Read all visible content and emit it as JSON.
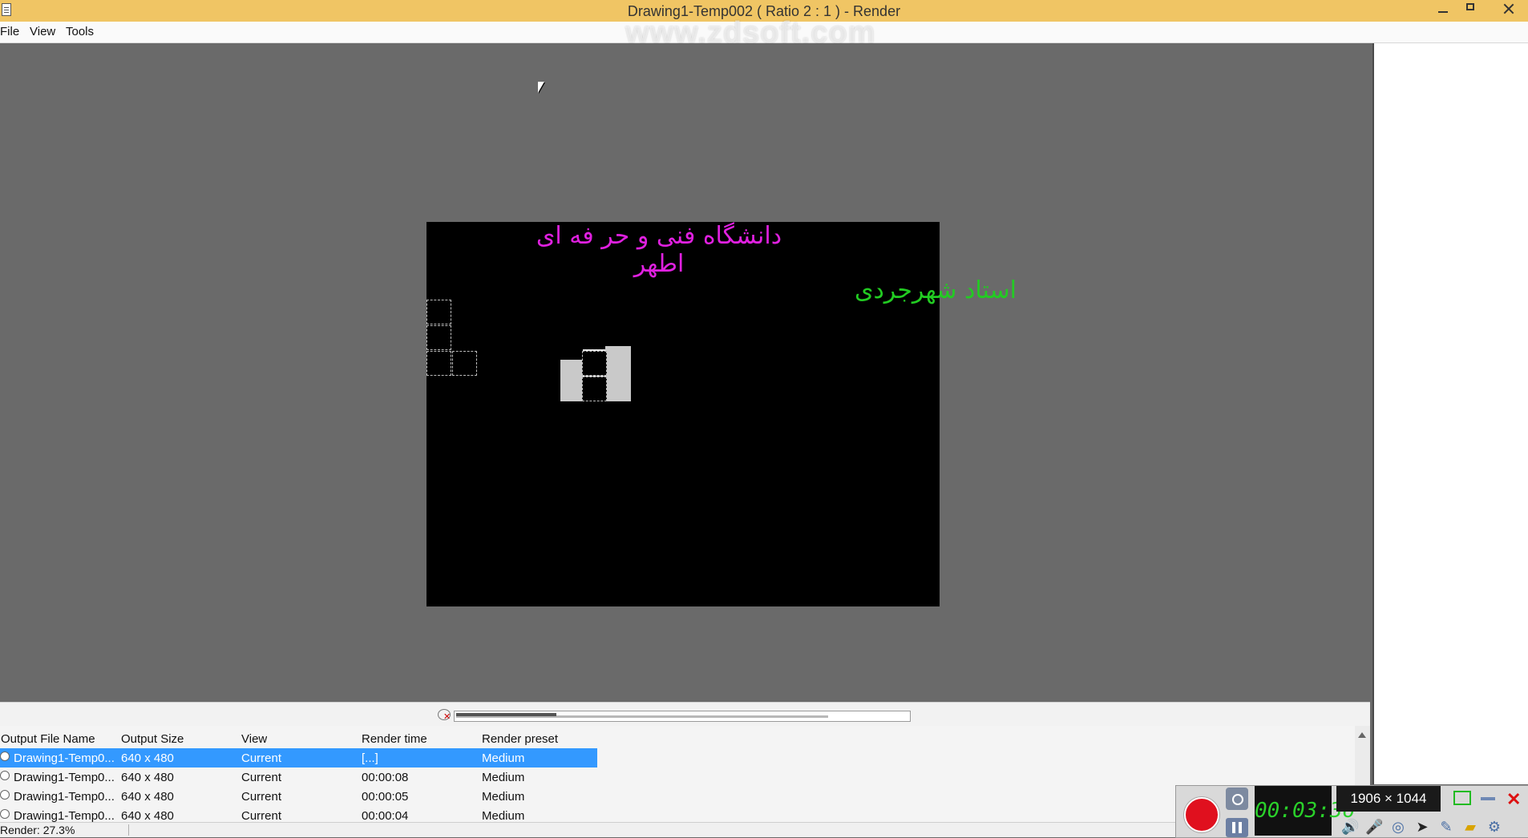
{
  "window": {
    "title": "Drawing1-Temp002  ( Ratio 2 : 1 ) - Render"
  },
  "menu": {
    "items": [
      "File",
      "View",
      "Tools"
    ]
  },
  "watermark": "www.zdsoft.com",
  "canvas": {
    "text_top": "دانشگاه فنی و حر فه ای اطهر",
    "text_name": "استاد شهرجردی",
    "text_top_color": "#e020e0",
    "text_name_color": "#22cc22"
  },
  "progress": {
    "fraction": 0.27
  },
  "queue": {
    "columns": [
      "Output File Name",
      "Output Size",
      "View",
      "Render time",
      "Render preset"
    ],
    "rows": [
      {
        "name": "Drawing1-Temp0...",
        "size": "640 x 480",
        "view": "Current",
        "time": "[...]",
        "preset": "Medium",
        "selected": true
      },
      {
        "name": "Drawing1-Temp0...",
        "size": "640 x 480",
        "view": "Current",
        "time": "00:00:08",
        "preset": "Medium",
        "selected": false
      },
      {
        "name": "Drawing1-Temp0...",
        "size": "640 x 480",
        "view": "Current",
        "time": "00:00:05",
        "preset": "Medium",
        "selected": false
      },
      {
        "name": "Drawing1-Temp0...",
        "size": "640 x 480",
        "view": "Current",
        "time": "00:00:04",
        "preset": "Medium",
        "selected": false
      }
    ]
  },
  "status": {
    "text": "Render: 27.3%"
  },
  "recorder": {
    "timer": "00:03:36",
    "dimensions": "1906 × 1044",
    "accent": "#e0101e"
  }
}
